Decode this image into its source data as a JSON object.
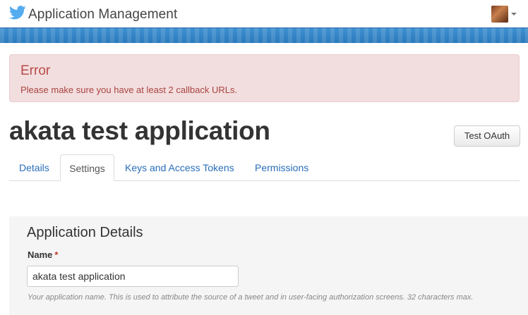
{
  "header": {
    "app_title": "Application Management",
    "logo_icon": "twitter-bird-icon",
    "avatar_icon": "user-avatar",
    "brand_color": "#55acee",
    "stripe_color": "#2f80c4"
  },
  "alert": {
    "title": "Error",
    "message": "Please make sure you have at least 2 callback URLs.",
    "bg_color": "#f2dede",
    "text_color": "#a94442"
  },
  "app": {
    "name": "akata test application",
    "test_button": "Test OAuth"
  },
  "tabs": [
    {
      "label": "Details",
      "active": false
    },
    {
      "label": "Settings",
      "active": true
    },
    {
      "label": "Keys and Access Tokens",
      "active": false
    },
    {
      "label": "Permissions",
      "active": false
    }
  ],
  "form": {
    "section_title": "Application Details",
    "name_label": "Name",
    "required_marker": "*",
    "name_value": "akata test application",
    "name_help": "Your application name. This is used to attribute the source of a tweet and in user-facing authorization screens. 32 characters max."
  }
}
